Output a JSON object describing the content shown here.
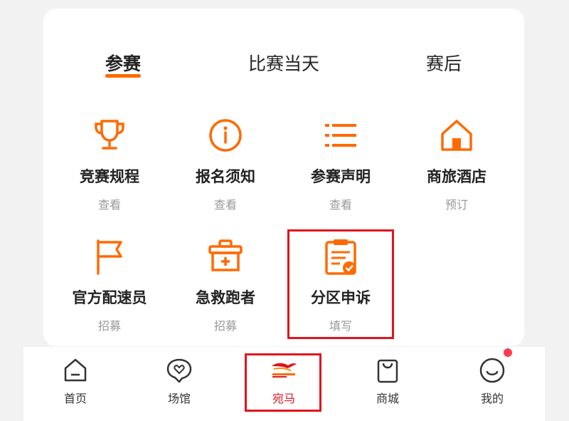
{
  "tabs": [
    {
      "label": "参赛",
      "active": true
    },
    {
      "label": "比赛当天",
      "active": false
    },
    {
      "label": "赛后",
      "active": false
    }
  ],
  "grid": [
    {
      "icon": "trophy-icon",
      "title": "竞赛规程",
      "sub": "查看"
    },
    {
      "icon": "info-icon",
      "title": "报名须知",
      "sub": "查看"
    },
    {
      "icon": "list-icon",
      "title": "参赛声明",
      "sub": "查看"
    },
    {
      "icon": "home-icon",
      "title": "商旅酒店",
      "sub": "预订"
    },
    {
      "icon": "flag-icon",
      "title": "官方配速员",
      "sub": "招募"
    },
    {
      "icon": "first-aid-kit-icon",
      "title": "急救跑者",
      "sub": "招募"
    },
    {
      "icon": "clipboard-check-icon",
      "title": "分区申诉",
      "sub": "填写"
    }
  ],
  "tabbar": [
    {
      "icon": "home-outline-icon",
      "label": "首页"
    },
    {
      "icon": "venue-heart-icon",
      "label": "场馆"
    },
    {
      "icon": "wanma-logo-icon",
      "label": "宛马",
      "active": true
    },
    {
      "icon": "shopping-bag-icon",
      "label": "商城"
    },
    {
      "icon": "smiley-face-icon",
      "label": "我的",
      "badge": true
    }
  ],
  "colors": {
    "accent": "#ff6a00",
    "highlight": "#e0141e",
    "badge": "#ff3b4f"
  }
}
